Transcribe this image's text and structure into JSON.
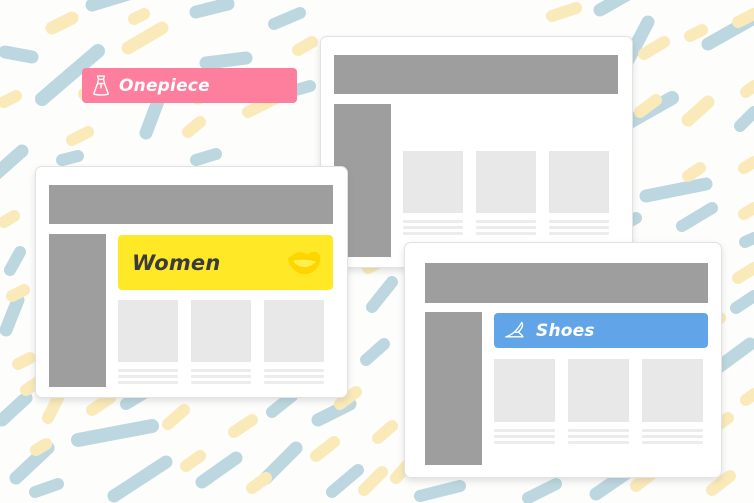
{
  "scene": {
    "title": "E-commerce category banner mockups",
    "background": {
      "base_color": "#fdfdfc",
      "confetti_blue": "#bcd7e0",
      "confetti_yellow": "#fbeab9"
    }
  },
  "cards": [
    {
      "id": "onepiece",
      "banner": {
        "label": "Onepiece",
        "icon": "dress-icon",
        "background_color": "#fd7e9d",
        "text_color": "#ffffff"
      },
      "header_color": "#9e9e9e",
      "sidebar_color": "#9e9e9e",
      "tile_color": "#e8e8e8",
      "line_color": "#ececec",
      "tiles": 3,
      "lines_per_tile": 3
    },
    {
      "id": "women",
      "banner": {
        "label": "Women",
        "icon": "lips-icon",
        "background_color": "#ffe927",
        "text_color": "#3b3b3b"
      },
      "header_color": "#9e9e9e",
      "sidebar_color": "#9e9e9e",
      "tile_color": "#e8e8e8",
      "line_color": "#ececec",
      "tiles": 3,
      "lines_per_tile": 3
    },
    {
      "id": "shoes",
      "banner": {
        "label": "Shoes",
        "icon": "high-heel-shoe-icon",
        "background_color": "#61a5e8",
        "text_color": "#ffffff"
      },
      "header_color": "#9e9e9e",
      "sidebar_color": "#9e9e9e",
      "tile_color": "#e8e8e8",
      "line_color": "#ececec",
      "tiles": 3,
      "lines_per_tile": 3
    }
  ]
}
